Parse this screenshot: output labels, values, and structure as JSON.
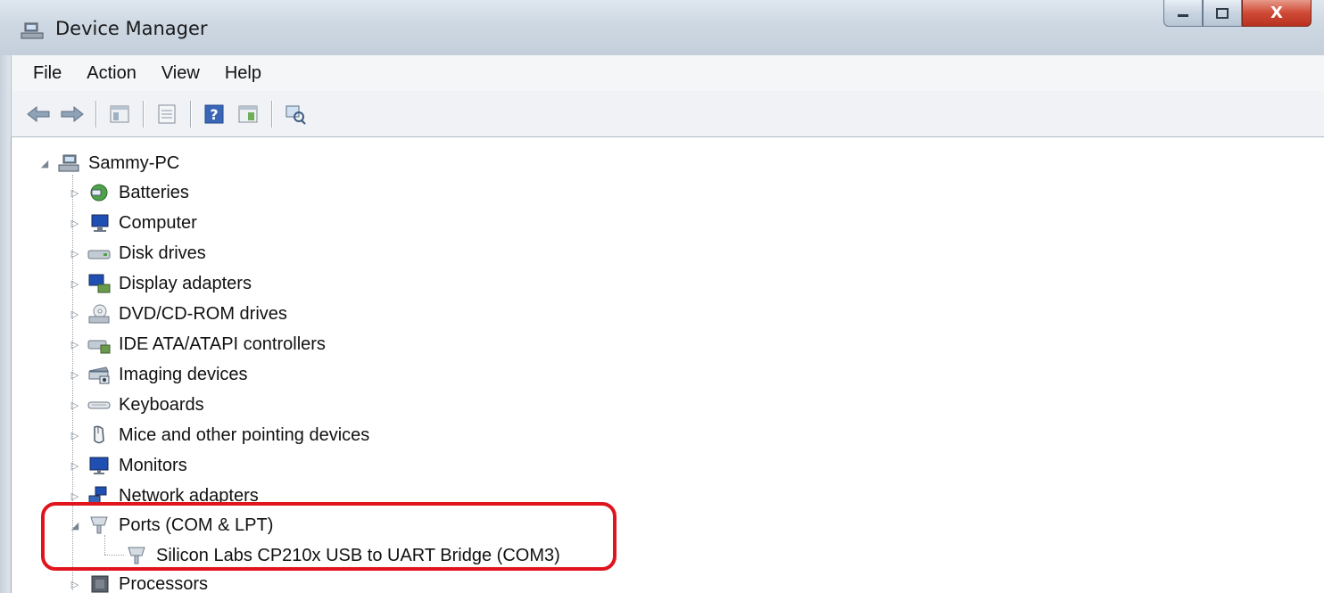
{
  "window": {
    "title": "Device Manager",
    "close_glyph": "X"
  },
  "menu": [
    "File",
    "Action",
    "View",
    "Help"
  ],
  "toolbar": {
    "buttons": [
      "back-icon",
      "forward-icon",
      "properties-icon",
      "show-hide-tree-icon",
      "help-icon",
      "update-driver-icon",
      "scan-hardware-icon"
    ]
  },
  "tree": {
    "root": "Sammy-PC",
    "categories": [
      "Batteries",
      "Computer",
      "Disk drives",
      "Display adapters",
      "DVD/CD-ROM drives",
      "IDE ATA/ATAPI controllers",
      "Imaging devices",
      "Keyboards",
      "Mice and other pointing devices",
      "Monitors",
      "Network adapters",
      "Ports (COM & LPT)",
      "Processors"
    ],
    "ports_children": [
      "Silicon Labs CP210x USB to UART Bridge (COM3)"
    ]
  },
  "colors": {
    "highlight": "#e0141c",
    "titlebar": "#cfd9e4",
    "close_button": "#cf4a36"
  }
}
